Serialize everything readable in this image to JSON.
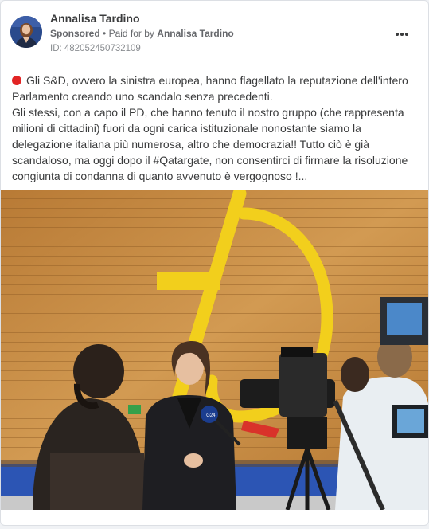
{
  "post": {
    "author": "Annalisa Tardino",
    "sponsored_label": "Sponsored",
    "separator": "•",
    "paid_prefix": "Paid for by",
    "paid_by": "Annalisa Tardino",
    "ad_id": "ID: 482052450732109",
    "more_icon": "more-horizontal-icon",
    "status_icon": "red-circle-icon",
    "text_paragraph_1": "Gli S&D, ovvero la sinistra europea, hanno flagellato la reputazione dell'intero Parlamento creando uno scandalo senza precedenti.",
    "text_paragraph_2": "Gli stessi, con a capo il PD, che hanno tenuto il nostro gruppo (che rappresenta milioni di cittadini) fuori da ogni carica istituzionale nonostante siamo la delegazione italiana più numerosa, altro che democrazia!! Tutto ciò è già scandaloso, ma oggi dopo il #Qatargate, non consentirci di firmare la risoluzione congiunta di condanna di quanto avvenuto è vergognoso !..."
  },
  "photo": {
    "logo_text": "EP",
    "microphone_label": "TG24",
    "colors": {
      "wood": "#c98f45",
      "logo": "#f2cf1c",
      "floor": "#2f58b8"
    }
  }
}
